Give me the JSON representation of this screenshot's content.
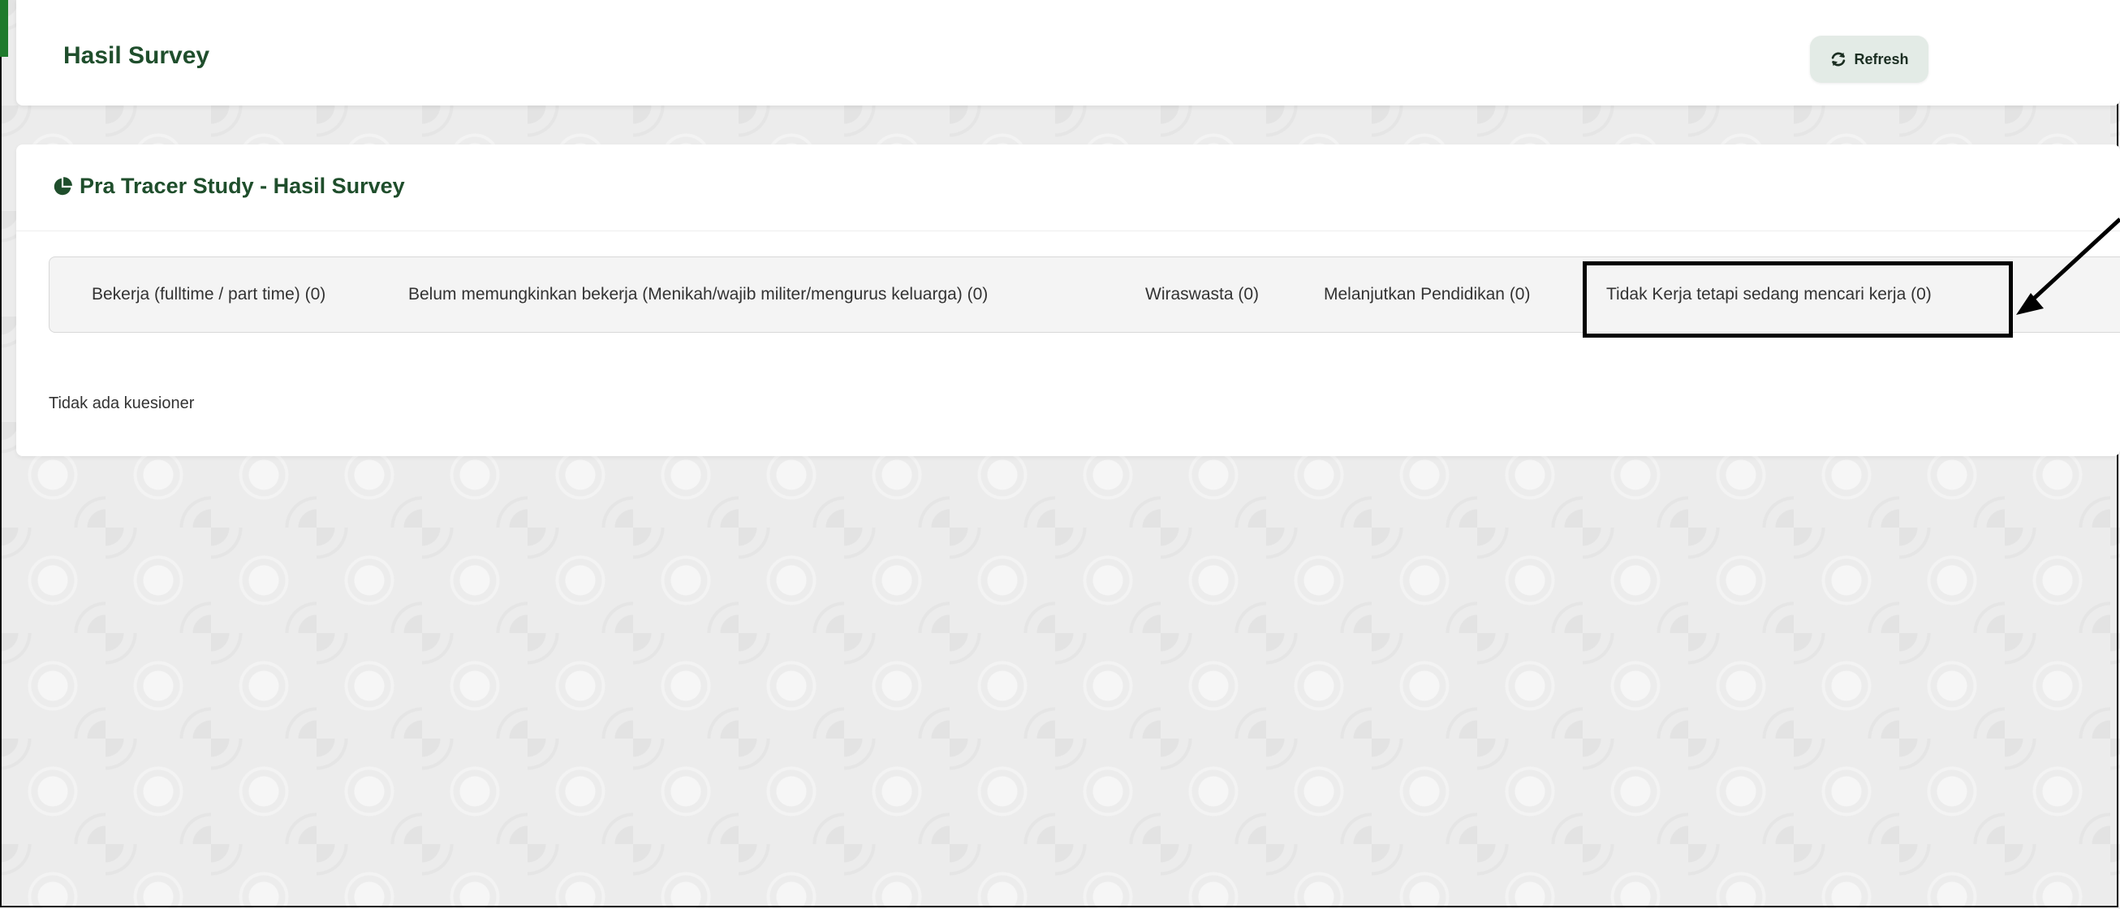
{
  "header": {
    "title": "Hasil Survey",
    "refresh_icon": "refresh-icon",
    "refresh_label": "Refresh"
  },
  "survey_card": {
    "icon": "pie-chart-icon",
    "title": "Pra Tracer Study - Hasil Survey",
    "tabs": [
      {
        "label": "Bekerja (fulltime / part time) (0)"
      },
      {
        "label": "Belum memungkinkan bekerja (Menikah/wajib militer/mengurus keluarga) (0)"
      },
      {
        "label": "Wiraswasta (0)"
      },
      {
        "label": "Melanjutkan Pendidikan (0)"
      },
      {
        "label": "Tidak Kerja tetapi sedang mencari kerja (0)"
      }
    ],
    "empty_message": "Tidak ada kuesioner"
  },
  "colors": {
    "brand_green": "#1f4e2c",
    "accent_green": "#1f7a2c",
    "button_bg": "#e3ebe6",
    "annotation": "#000000"
  }
}
